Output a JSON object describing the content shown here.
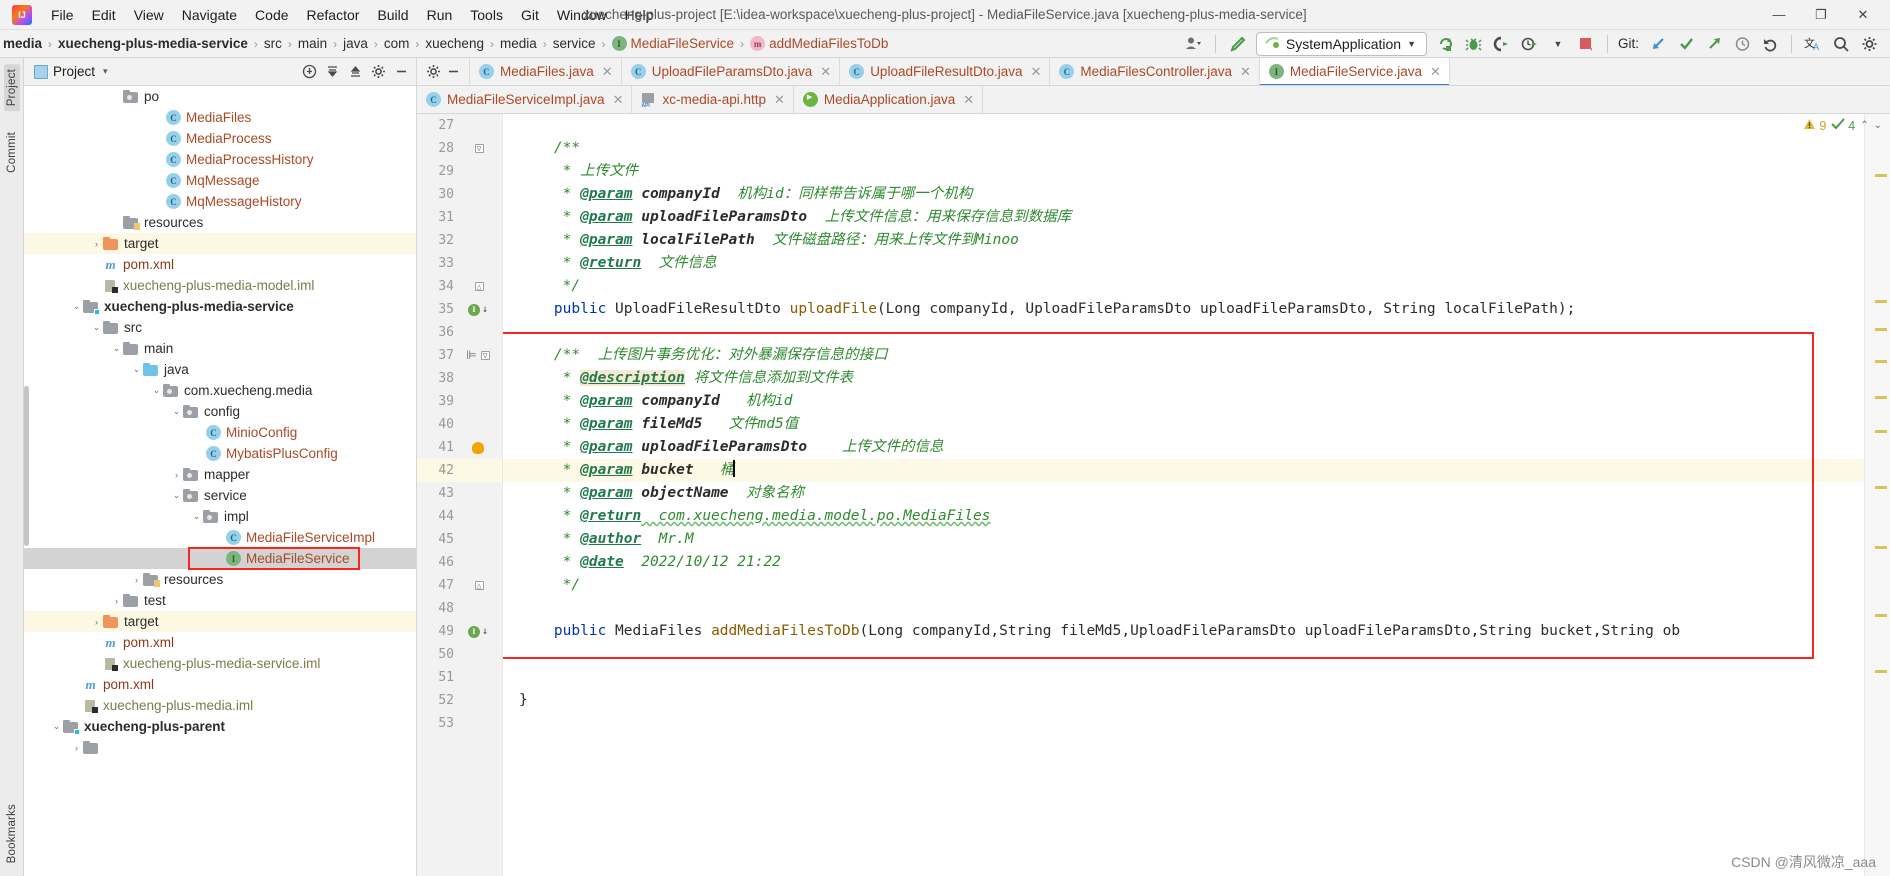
{
  "window": {
    "title": "xuecheng-plus-project [E:\\idea-workspace\\xuecheng-plus-project] - MediaFileService.java [xuecheng-plus-media-service]",
    "logo_text": "IJ",
    "minimize": "—",
    "maximize": "❐",
    "close": "✕"
  },
  "menubar": {
    "items": [
      {
        "label": "File"
      },
      {
        "label": "Edit"
      },
      {
        "label": "View"
      },
      {
        "label": "Navigate"
      },
      {
        "label": "Code"
      },
      {
        "label": "Refactor"
      },
      {
        "label": "Build"
      },
      {
        "label": "Run"
      },
      {
        "label": "Tools"
      },
      {
        "label": "Git"
      },
      {
        "label": "Window"
      },
      {
        "label": "Help"
      }
    ]
  },
  "navbar": {
    "crumbs": [
      {
        "label": "media",
        "bold": true,
        "icon": null
      },
      {
        "label": "xuecheng-plus-media-service",
        "bold": true,
        "icon": null
      },
      {
        "label": "src",
        "bold": false,
        "icon": null
      },
      {
        "label": "main",
        "bold": false,
        "icon": null
      },
      {
        "label": "java",
        "bold": false,
        "icon": null
      },
      {
        "label": "com",
        "bold": false,
        "icon": null
      },
      {
        "label": "xuecheng",
        "bold": false,
        "icon": null
      },
      {
        "label": "media",
        "bold": false,
        "icon": null
      },
      {
        "label": "service",
        "bold": false,
        "icon": null
      },
      {
        "label": "MediaFileService",
        "bold": false,
        "icon": "interface-icon",
        "icon_letter": "I"
      },
      {
        "label": "addMediaFilesToDb",
        "bold": false,
        "icon": "method-icon",
        "icon_letter": "m"
      }
    ],
    "separator": "›",
    "run_configuration": "SystemApplication",
    "git_label": "Git:",
    "toolbar_icons": [
      "user-avatar-icon",
      "dropdown-caret-icon",
      "build-hammer-icon",
      "rerun-icon",
      "debug-bug-icon",
      "coverage-icon",
      "profiler-icon",
      "profiler-caret-icon",
      "stop-icon",
      "git-update-icon",
      "git-commit-icon",
      "git-push-icon",
      "git-history-icon",
      "git-rollback-icon",
      "translate-icon",
      "search-icon",
      "settings-gear-icon"
    ]
  },
  "left_stripe": {
    "top": [
      {
        "label": "Project",
        "selected": true
      },
      {
        "label": "Commit",
        "selected": false
      }
    ],
    "bottom": [
      {
        "label": "Bookmarks",
        "selected": false
      }
    ]
  },
  "project_panel": {
    "title": "Project",
    "caret": "▾",
    "tools": [
      "locate-icon",
      "collapse-all-icon",
      "expand-icon",
      "settings-gear-icon",
      "hide-icon"
    ],
    "tree": [
      {
        "indent": 4,
        "arrow": "",
        "icon": "package-folder",
        "label": "po",
        "style": "plain",
        "hl": "none"
      },
      {
        "indent": 6,
        "arrow": "",
        "icon": "class",
        "label": "MediaFiles",
        "style": "class",
        "hl": "none"
      },
      {
        "indent": 6,
        "arrow": "",
        "icon": "class",
        "label": "MediaProcess",
        "style": "class",
        "hl": "none"
      },
      {
        "indent": 6,
        "arrow": "",
        "icon": "class",
        "label": "MediaProcessHistory",
        "style": "class",
        "hl": "none"
      },
      {
        "indent": 6,
        "arrow": "",
        "icon": "class",
        "label": "MqMessage",
        "style": "class",
        "hl": "none"
      },
      {
        "indent": 6,
        "arrow": "",
        "icon": "class",
        "label": "MqMessageHistory",
        "style": "class",
        "hl": "none"
      },
      {
        "indent": 4,
        "arrow": "",
        "icon": "resources",
        "label": "resources",
        "style": "plain",
        "hl": "none"
      },
      {
        "indent": 3,
        "arrow": "›",
        "icon": "orange-folder",
        "label": "target",
        "style": "plain",
        "hl": "yellow"
      },
      {
        "indent": 3,
        "arrow": "",
        "icon": "maven",
        "label": "pom.xml",
        "style": "xml",
        "hl": "none"
      },
      {
        "indent": 3,
        "arrow": "",
        "icon": "iml",
        "label": "xuecheng-plus-media-model.iml",
        "style": "iml",
        "hl": "none"
      },
      {
        "indent": 2,
        "arrow": "⌄",
        "icon": "module-folder",
        "label": "xuecheng-plus-media-service",
        "style": "bold",
        "hl": "none"
      },
      {
        "indent": 3,
        "arrow": "⌄",
        "icon": "grey-folder",
        "label": "src",
        "style": "plain",
        "hl": "none"
      },
      {
        "indent": 4,
        "arrow": "⌄",
        "icon": "grey-folder",
        "label": "main",
        "style": "plain",
        "hl": "none"
      },
      {
        "indent": 5,
        "arrow": "⌄",
        "icon": "blue-folder",
        "label": "java",
        "style": "plain",
        "hl": "none"
      },
      {
        "indent": 6,
        "arrow": "⌄",
        "icon": "package-folder",
        "label": "com.xuecheng.media",
        "style": "plain",
        "hl": "none"
      },
      {
        "indent": 7,
        "arrow": "⌄",
        "icon": "package-folder",
        "label": "config",
        "style": "plain",
        "hl": "none"
      },
      {
        "indent": 8,
        "arrow": "",
        "icon": "class",
        "label": "MinioConfig",
        "style": "class",
        "hl": "none"
      },
      {
        "indent": 8,
        "arrow": "",
        "icon": "class",
        "label": "MybatisPlusConfig",
        "style": "class",
        "hl": "none"
      },
      {
        "indent": 7,
        "arrow": "›",
        "icon": "package-folder",
        "label": "mapper",
        "style": "plain",
        "hl": "none"
      },
      {
        "indent": 7,
        "arrow": "⌄",
        "icon": "package-folder",
        "label": "service",
        "style": "plain",
        "hl": "none"
      },
      {
        "indent": 8,
        "arrow": "⌄",
        "icon": "package-folder",
        "label": "impl",
        "style": "plain",
        "hl": "none"
      },
      {
        "indent": 9,
        "arrow": "",
        "icon": "class",
        "label": "MediaFileServiceImpl",
        "style": "class",
        "hl": "none"
      },
      {
        "indent": 9,
        "arrow": "",
        "icon": "interface",
        "label": "MediaFileService",
        "style": "class",
        "hl": "grey"
      },
      {
        "indent": 5,
        "arrow": "›",
        "icon": "resources",
        "label": "resources",
        "style": "plain",
        "hl": "none"
      },
      {
        "indent": 4,
        "arrow": "›",
        "icon": "grey-folder",
        "label": "test",
        "style": "plain",
        "hl": "none"
      },
      {
        "indent": 3,
        "arrow": "›",
        "icon": "orange-folder",
        "label": "target",
        "style": "plain",
        "hl": "yellow"
      },
      {
        "indent": 3,
        "arrow": "",
        "icon": "maven",
        "label": "pom.xml",
        "style": "xml",
        "hl": "none"
      },
      {
        "indent": 3,
        "arrow": "",
        "icon": "iml",
        "label": "xuecheng-plus-media-service.iml",
        "style": "iml",
        "hl": "none"
      },
      {
        "indent": 2,
        "arrow": "",
        "icon": "maven",
        "label": "pom.xml",
        "style": "xml",
        "hl": "none"
      },
      {
        "indent": 2,
        "arrow": "",
        "icon": "iml",
        "label": "xuecheng-plus-media.iml",
        "style": "iml",
        "hl": "none"
      },
      {
        "indent": 1,
        "arrow": "⌄",
        "icon": "module-folder",
        "label": "xuecheng-plus-parent",
        "style": "bold",
        "hl": "none"
      },
      {
        "indent": 2,
        "arrow": "›",
        "icon": "grey-folder",
        "label": "",
        "style": "plain",
        "hl": "none"
      }
    ]
  },
  "editor": {
    "tabs_row1": [
      {
        "label": "MediaFiles.java",
        "icon": "class-icon",
        "icon_letter": "C",
        "active": false
      },
      {
        "label": "UploadFileParamsDto.java",
        "icon": "class-icon",
        "icon_letter": "C",
        "active": false
      },
      {
        "label": "UploadFileResultDto.java",
        "icon": "class-icon",
        "icon_letter": "C",
        "active": false
      },
      {
        "label": "MediaFilesController.java",
        "icon": "class-icon",
        "icon_letter": "C",
        "active": false
      },
      {
        "label": "MediaFileService.java",
        "icon": "interface-icon",
        "icon_letter": "I",
        "active": true
      }
    ],
    "tabs_row2": [
      {
        "label": "MediaFileServiceImpl.java",
        "icon": "class-icon",
        "icon_letter": "C",
        "active": false
      },
      {
        "label": "xc-media-api.http",
        "icon": "http-file-icon",
        "icon_letter": "",
        "active": false
      },
      {
        "label": "MediaApplication.java",
        "icon": "spring-boot-icon",
        "icon_letter": "",
        "active": false
      }
    ],
    "close_glyph": "✕",
    "inspections": {
      "warning_count": "9",
      "ok_count": "4",
      "warning_icon": "warning-triangle-icon",
      "ok_icon": "checkmark-icon"
    },
    "lines": [
      {
        "n": "27",
        "marker": "",
        "fold": "",
        "current": false,
        "tokens": []
      },
      {
        "n": "28",
        "marker": "",
        "fold": "open",
        "current": false,
        "tokens": [
          {
            "t": "    ",
            "c": "cplain"
          },
          {
            "t": "/**",
            "c": "cm"
          }
        ]
      },
      {
        "n": "29",
        "marker": "",
        "fold": "",
        "current": false,
        "tokens": [
          {
            "t": "     * ",
            "c": "cm"
          },
          {
            "t": "上传文件",
            "c": "cm"
          }
        ]
      },
      {
        "n": "30",
        "marker": "",
        "fold": "",
        "current": false,
        "tokens": [
          {
            "t": "     * ",
            "c": "cm"
          },
          {
            "t": "@param",
            "c": "ctag"
          },
          {
            "t": " ",
            "c": "cm"
          },
          {
            "t": "companyId",
            "c": "cparam"
          },
          {
            "t": "  机构id：同样带告诉属于哪一个机构",
            "c": "cm"
          }
        ]
      },
      {
        "n": "31",
        "marker": "",
        "fold": "",
        "current": false,
        "tokens": [
          {
            "t": "     * ",
            "c": "cm"
          },
          {
            "t": "@param",
            "c": "ctag"
          },
          {
            "t": " ",
            "c": "cm"
          },
          {
            "t": "uploadFileParamsDto",
            "c": "cparam"
          },
          {
            "t": "  上传文件信息：用来保存信息到数据库",
            "c": "cm"
          }
        ]
      },
      {
        "n": "32",
        "marker": "",
        "fold": "",
        "current": false,
        "tokens": [
          {
            "t": "     * ",
            "c": "cm"
          },
          {
            "t": "@param",
            "c": "ctag"
          },
          {
            "t": " ",
            "c": "cm"
          },
          {
            "t": "localFilePath",
            "c": "cparam"
          },
          {
            "t": "  文件磁盘路径：用来上传文件到Minoo",
            "c": "cm"
          }
        ]
      },
      {
        "n": "33",
        "marker": "",
        "fold": "",
        "current": false,
        "tokens": [
          {
            "t": "     * ",
            "c": "cm"
          },
          {
            "t": "@return",
            "c": "ctag"
          },
          {
            "t": "  文件信息",
            "c": "cm"
          }
        ]
      },
      {
        "n": "34",
        "marker": "",
        "fold": "close",
        "current": false,
        "tokens": [
          {
            "t": "     */",
            "c": "cm"
          }
        ]
      },
      {
        "n": "35",
        "marker": "run",
        "fold": "",
        "current": false,
        "tokens": [
          {
            "t": "    ",
            "c": "cplain"
          },
          {
            "t": "public",
            "c": "ckw"
          },
          {
            "t": " UploadFileResultDto ",
            "c": "ctype"
          },
          {
            "t": "uploadFile",
            "c": "cmeth"
          },
          {
            "t": "(Long companyId, UploadFileParamsDto uploadFileParamsDto, String localFilePath);",
            "c": "ctype"
          }
        ]
      },
      {
        "n": "36",
        "marker": "",
        "fold": "",
        "current": false,
        "tokens": []
      },
      {
        "n": "37",
        "marker": "indent",
        "fold": "open",
        "current": false,
        "tokens": [
          {
            "t": "    ",
            "c": "cplain"
          },
          {
            "t": "/**  上传图片事务优化：对外暴漏保存信息的接口",
            "c": "cm"
          }
        ]
      },
      {
        "n": "38",
        "marker": "",
        "fold": "",
        "current": false,
        "tokens": [
          {
            "t": "     * ",
            "c": "cm"
          },
          {
            "t": "@description",
            "c": "ctag-hl"
          },
          {
            "t": " 将文件信息添加到文件表",
            "c": "cm"
          }
        ]
      },
      {
        "n": "39",
        "marker": "",
        "fold": "",
        "current": false,
        "tokens": [
          {
            "t": "     * ",
            "c": "cm"
          },
          {
            "t": "@param",
            "c": "ctag"
          },
          {
            "t": " ",
            "c": "cm"
          },
          {
            "t": "companyId",
            "c": "cparam"
          },
          {
            "t": "   机构id",
            "c": "cm"
          }
        ]
      },
      {
        "n": "40",
        "marker": "",
        "fold": "",
        "current": false,
        "tokens": [
          {
            "t": "     * ",
            "c": "cm"
          },
          {
            "t": "@param",
            "c": "ctag"
          },
          {
            "t": " ",
            "c": "cm"
          },
          {
            "t": "fileMd5",
            "c": "cparam"
          },
          {
            "t": "   文件md5值",
            "c": "cm"
          }
        ]
      },
      {
        "n": "41",
        "marker": "bulb",
        "fold": "",
        "current": false,
        "tokens": [
          {
            "t": "     * ",
            "c": "cm"
          },
          {
            "t": "@param",
            "c": "ctag"
          },
          {
            "t": " ",
            "c": "cm"
          },
          {
            "t": "uploadFileParamsDto",
            "c": "cparam"
          },
          {
            "t": "    上传文件的信息",
            "c": "cm"
          }
        ]
      },
      {
        "n": "42",
        "marker": "",
        "fold": "",
        "current": true,
        "tokens": [
          {
            "t": "     * ",
            "c": "cm"
          },
          {
            "t": "@param",
            "c": "ctag"
          },
          {
            "t": " ",
            "c": "cm"
          },
          {
            "t": "bucket",
            "c": "cparam"
          },
          {
            "t": "   桶",
            "c": "cm"
          },
          {
            "t": "CARET",
            "c": "caret"
          }
        ]
      },
      {
        "n": "43",
        "marker": "",
        "fold": "",
        "current": false,
        "tokens": [
          {
            "t": "     * ",
            "c": "cm"
          },
          {
            "t": "@param",
            "c": "ctag"
          },
          {
            "t": " ",
            "c": "cm"
          },
          {
            "t": "objectName",
            "c": "cparam"
          },
          {
            "t": "  对象名称",
            "c": "cm"
          }
        ]
      },
      {
        "n": "44",
        "marker": "",
        "fold": "",
        "current": false,
        "tokens": [
          {
            "t": "     * ",
            "c": "cm"
          },
          {
            "t": "@return",
            "c": "ctag"
          },
          {
            "t": "  com.xuecheng.media.model.po.MediaFiles",
            "c": "cm"
          }
        ]
      },
      {
        "n": "45",
        "marker": "",
        "fold": "",
        "current": false,
        "tokens": [
          {
            "t": "     * ",
            "c": "cm"
          },
          {
            "t": "@author",
            "c": "ctag"
          },
          {
            "t": "  Mr.M",
            "c": "cm"
          }
        ]
      },
      {
        "n": "46",
        "marker": "",
        "fold": "",
        "current": false,
        "tokens": [
          {
            "t": "     * ",
            "c": "cm"
          },
          {
            "t": "@date",
            "c": "ctag"
          },
          {
            "t": "  2022/10/12 21:22",
            "c": "cm"
          }
        ]
      },
      {
        "n": "47",
        "marker": "",
        "fold": "close",
        "current": false,
        "tokens": [
          {
            "t": "     */",
            "c": "cm"
          }
        ]
      },
      {
        "n": "48",
        "marker": "",
        "fold": "",
        "current": false,
        "tokens": []
      },
      {
        "n": "49",
        "marker": "run",
        "fold": "",
        "current": false,
        "tokens": [
          {
            "t": "    ",
            "c": "cplain"
          },
          {
            "t": "public",
            "c": "ckw"
          },
          {
            "t": " MediaFiles ",
            "c": "ctype"
          },
          {
            "t": "addMediaFilesToDb",
            "c": "cmeth"
          },
          {
            "t": "(Long companyId,String fileMd5,UploadFileParamsDto uploadFileParamsDto,String bucket,String ob",
            "c": "ctype"
          }
        ]
      },
      {
        "n": "50",
        "marker": "",
        "fold": "",
        "current": false,
        "tokens": []
      },
      {
        "n": "51",
        "marker": "",
        "fold": "",
        "current": false,
        "tokens": []
      },
      {
        "n": "52",
        "marker": "",
        "fold": "",
        "current": false,
        "tokens": [
          {
            "t": "}",
            "c": "cplain"
          }
        ]
      },
      {
        "n": "53",
        "marker": "",
        "fold": "",
        "current": false,
        "tokens": []
      }
    ]
  },
  "watermark": "CSDN @清风微凉_aaa",
  "colors": {
    "accent_blue": "#3b7fd4",
    "highlight_red": "#f4261f",
    "comment_green": "#308a30",
    "keyword_blue": "#0033b3",
    "current_line": "#fdf9e6",
    "selection_grey": "#d3d3d3"
  }
}
